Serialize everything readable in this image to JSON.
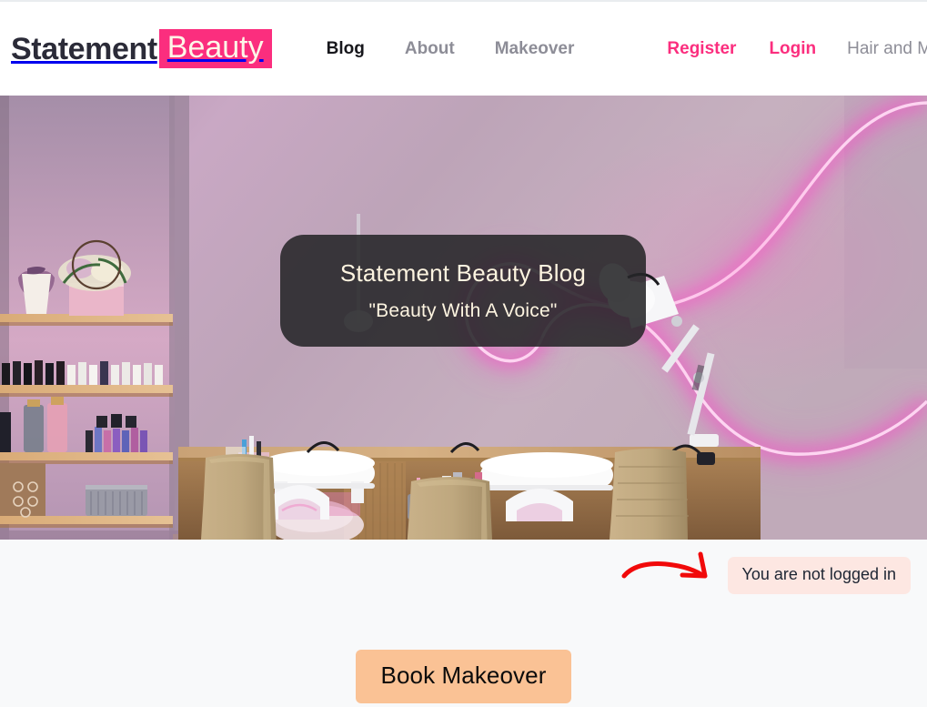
{
  "brand": {
    "word_one": "Statement",
    "word_two": "Beauty",
    "accent_color": "#fb2e7e",
    "text_on_accent": "#fdf6e8"
  },
  "nav": {
    "items": [
      {
        "label": "Blog",
        "state": "active"
      },
      {
        "label": "About",
        "state": "muted"
      },
      {
        "label": "Makeover",
        "state": "muted"
      }
    ],
    "auth": [
      {
        "label": "Register",
        "style": "accent"
      },
      {
        "label": "Login",
        "style": "accent"
      },
      {
        "label": "Hair and Makeup",
        "style": "plain"
      }
    ]
  },
  "hero": {
    "title": "Statement Beauty Blog",
    "tagline": "\"Beauty With A Voice\"",
    "overlay_bg": "rgba(38,38,40,0.88)",
    "text_color": "#fdf4e0",
    "scene": "nail-salon-interior-with-pink-neon-sign"
  },
  "status": {
    "badge_text": "You are not logged in",
    "badge_bg": "#fde7e2",
    "badge_text_color": "#1d2533",
    "annotation_color": "#f10a0a"
  },
  "cta": {
    "label": "Book Makeover",
    "bg": "#fac295",
    "text_color": "#0b0b0b"
  }
}
